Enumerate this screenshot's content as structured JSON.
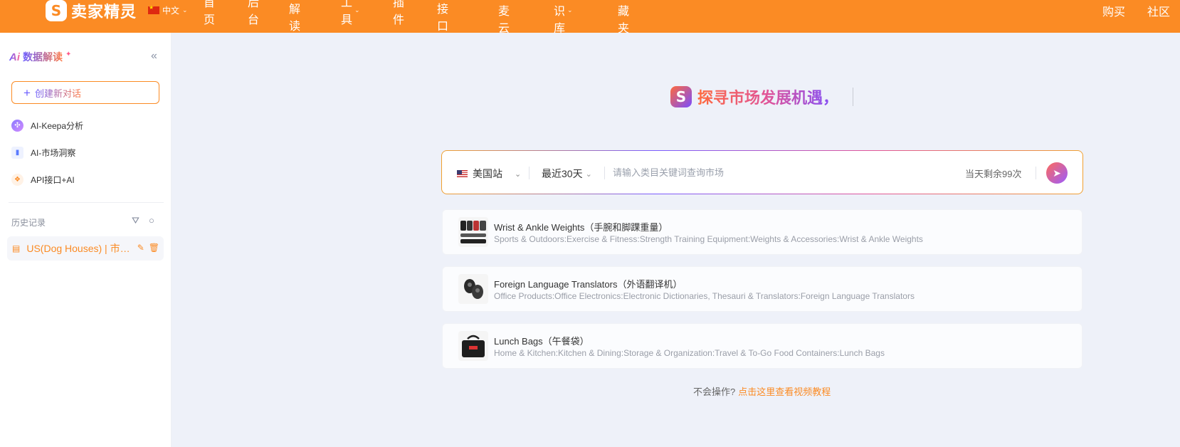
{
  "topbar": {
    "logo_text": "卖家精灵",
    "language": "中文",
    "nav": [
      {
        "label": "首页",
        "has_dropdown": false
      },
      {
        "label": "后台",
        "has_dropdown": false
      },
      {
        "label": "AI解读",
        "has_dropdown": false
      },
      {
        "label": "工具",
        "has_dropdown": true
      },
      {
        "label": "插件",
        "has_dropdown": false
      },
      {
        "label": "API接口",
        "has_dropdown": false
      },
      {
        "label": "优麦云",
        "has_dropdown": false
      },
      {
        "label": "知识库",
        "has_dropdown": true
      },
      {
        "label": "收藏夹",
        "has_dropdown": false
      }
    ],
    "buy": "购买",
    "community": "社区",
    "accent_color": "#fb8b24"
  },
  "sidebar": {
    "brand_mark": "Ai",
    "title": "数据解读",
    "new_chat_label": "创建新对话",
    "menu": [
      {
        "label": "AI-Keepa分析",
        "icon": "keepa-icon"
      },
      {
        "label": "AI-市场洞察",
        "icon": "chart-icon"
      },
      {
        "label": "API接口+AI",
        "icon": "api-icon"
      }
    ],
    "history_label": "历史记录",
    "history": [
      {
        "label": "US(Dog Houses) | 市场洞察"
      }
    ]
  },
  "main": {
    "hero_text": "探寻市场发展机遇，",
    "search": {
      "site": "美国站",
      "range": "最近30天",
      "placeholder": "请输入类目关键词查询市场",
      "remaining": "当天剩余99次"
    },
    "suggestions": [
      {
        "title": "Wrist & Ankle Weights（手腕和脚踝重量）",
        "path": "Sports & Outdoors:Exercise & Fitness:Strength Training Equipment:Weights & Accessories:Wrist & Ankle Weights"
      },
      {
        "title": "Foreign Language Translators（外语翻译机）",
        "path": "Office Products:Office Electronics:Electronic Dictionaries, Thesauri & Translators:Foreign Language Translators"
      },
      {
        "title": "Lunch Bags（午餐袋）",
        "path": "Home & Kitchen:Kitchen & Dining:Storage & Organization:Travel & To-Go Food Containers:Lunch Bags"
      }
    ],
    "help_text": "不会操作?",
    "help_link": "点击这里查看视频教程"
  }
}
